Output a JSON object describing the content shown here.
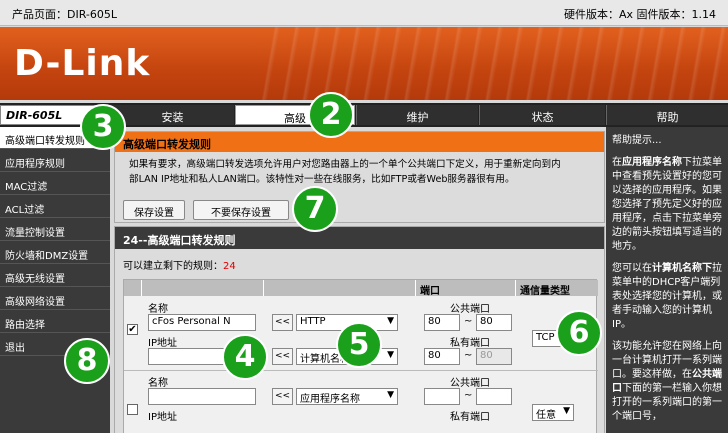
{
  "topbar": {
    "product_page": "产品页面：DIR-605L",
    "versions": "硬件版本：Ax   固件版本：1.14"
  },
  "banner": {
    "logo": "D-Link"
  },
  "model": "DIR-605L",
  "tabs": [
    "安装",
    "高级",
    "维护",
    "状态",
    "帮助"
  ],
  "active_tab": "高级",
  "sidebar": {
    "items": [
      "高级端口转发规则",
      "应用程序规则",
      "MAC过滤",
      "ACL过滤",
      "流量控制设置",
      "防火墙和DMZ设置",
      "高级无线设置",
      "高级网络设置",
      "路由选择",
      "退出"
    ]
  },
  "section1": {
    "title": "高级端口转发规则",
    "desc_line1": "如果有要求，高级端口转发选项允许用户对您路由器上的一个单个公共端口下定义，用于重新定向到内",
    "desc_line2": "部LAN IP地址和私人LAN端口。该特性对一些在线服务，比如FTP或者Web服务器很有用。",
    "save_label": "保存设置",
    "nosave_label": "不要保存设置"
  },
  "section2": {
    "title": "24--高级端口转发规则",
    "remaining_prefix": "可以建立剩下的规则：",
    "remaining_count": "24",
    "col_port": "端口",
    "col_traffic": "通信量类型",
    "rule1": {
      "checked": "✔",
      "name_label": "名称",
      "name_value": "cFos Personal N",
      "ip_label": "IP地址",
      "ip_value": "",
      "arrow": "<<",
      "app_select": "HTTP",
      "computer_select": "计算机名称",
      "public_label": "公共端口",
      "public_from": "80",
      "public_to": "80",
      "tilde": "~",
      "private_label": "私有端口",
      "private_from": "80",
      "private_to": "80",
      "traffic": "TCP"
    },
    "rule2": {
      "name_label": "名称",
      "ip_label": "IP地址",
      "app_select": "应用程序名称",
      "public_label": "公共端口",
      "private_label": "私有端口",
      "traffic": "任意"
    }
  },
  "help": {
    "title": "帮助提示...",
    "p1_pre": "在",
    "p1_bold": "应用程序名称",
    "p1_post": "下拉菜单中查看预先设置好的您可以选择的应用程序。如果您选择了预先定义好的应用程序，点击下拉菜单旁边的箭头按钮填写适当的地方。",
    "p2_pre": "您可以在",
    "p2_bold": "计算机名称下",
    "p2_post": "拉菜单中的DHCP客户端列表处选择您的计算机，或者手动输入您的计算机IP。",
    "p3_pre": "该功能允许您在网络上向一台计算机打开一系列端口。要这样做，在",
    "p3_bold": "公共端口",
    "p3_post": "下面的第一栏输入你想打开的一系列端口的第一个端口号，"
  },
  "badges": [
    "2",
    "3",
    "4",
    "5",
    "6",
    "7",
    "8"
  ],
  "colors": {
    "orange": "#f07016",
    "dark": "#3a3a3a",
    "badge_green": "#1aa01a"
  }
}
